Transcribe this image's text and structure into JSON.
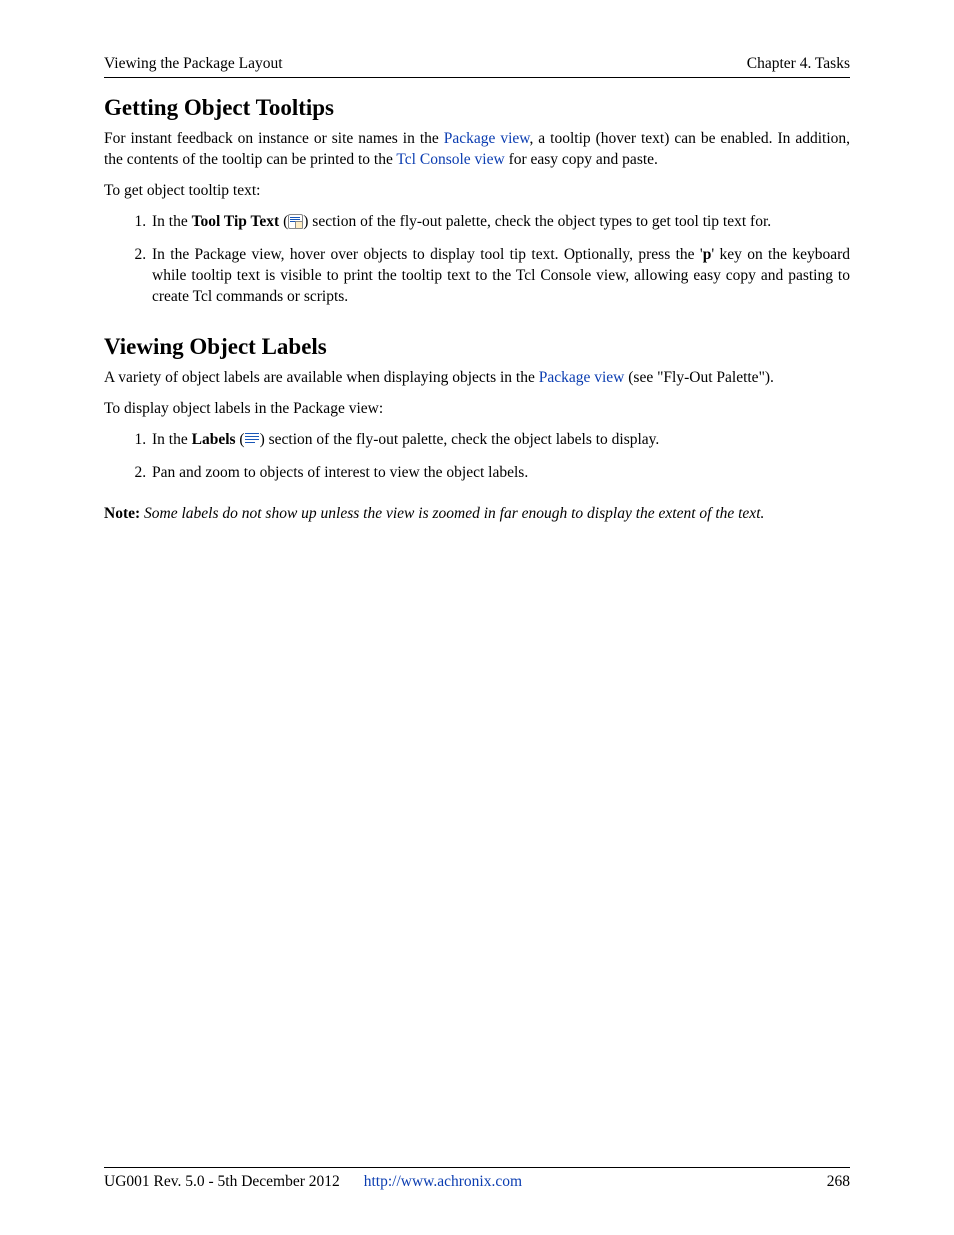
{
  "header": {
    "left": "Viewing the Package Layout",
    "right": "Chapter 4. Tasks"
  },
  "sec1": {
    "title": "Getting Object Tooltips",
    "para1_a": "For instant feedback on instance or site names in the ",
    "link1": "Package view",
    "para1_b": ", a tooltip (hover text) can be enabled. In addition, the contents of the tooltip can be printed to the ",
    "link2": "Tcl Console view",
    "para1_c": " for easy copy and paste.",
    "para2": "To get object tooltip text:",
    "li1_a": "In the ",
    "li1_bold": "Tool Tip Text",
    "li1_b": " (",
    "li1_c": ") section of the fly-out palette, check the object types to get tool tip text for.",
    "li2_a": "In the Package view, hover over objects to display tool tip text.  Optionally, press the '",
    "li2_key": "p",
    "li2_b": "' key on the keyboard while tooltip text is visible to print the tooltip text to the Tcl Console view, allowing easy copy and pasting to create Tcl commands or scripts."
  },
  "sec2": {
    "title": "Viewing Object Labels",
    "para1_a": "A variety of object labels are available when displaying objects in the ",
    "link1": "Package view",
    "para1_b": " (see \"Fly-Out Palette\").",
    "para2": "To display object labels in the Package view:",
    "li1_a": "In the ",
    "li1_bold": "Labels",
    "li1_b": " (",
    "li1_c": ") section of the fly-out palette, check the object labels to display.",
    "li2": "Pan and zoom to objects of interest to view the object labels."
  },
  "note": {
    "label": "Note:",
    "body": " Some labels do not show up unless the view is zoomed in far enough to display the extent of the text."
  },
  "footer": {
    "left": "UG001 Rev. 5.0 - 5th December 2012",
    "link": "http://www.achronix.com",
    "page": "268"
  }
}
